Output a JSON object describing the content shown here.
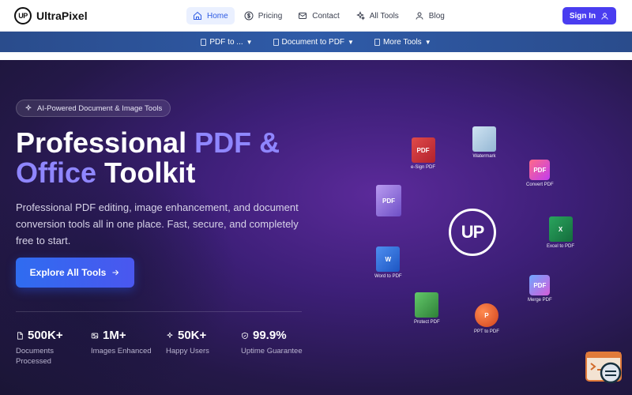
{
  "brand": {
    "logo_mark": "UP",
    "name": "UltraPixel"
  },
  "nav": {
    "items": [
      {
        "label": "Home",
        "icon": "home-icon",
        "active": true
      },
      {
        "label": "Pricing",
        "icon": "dollar-icon",
        "active": false
      },
      {
        "label": "Contact",
        "icon": "mail-icon",
        "active": false
      },
      {
        "label": "All Tools",
        "icon": "sparkles-icon",
        "active": false
      },
      {
        "label": "Blog",
        "icon": "user-icon",
        "active": false
      }
    ],
    "signin_label": "Sign In"
  },
  "subnav": {
    "items": [
      {
        "label": "PDF to ..."
      },
      {
        "label": "Document to PDF"
      },
      {
        "label": "More Tools"
      }
    ]
  },
  "hero": {
    "badge": "AI-Powered Document & Image Tools",
    "title_part1": "Professional ",
    "title_highlight1": "PDF &",
    "title_highlight2": "Office",
    "title_part2": " Toolkit",
    "description": "Professional PDF editing, image enhancement, and document conversion tools all in one place. Fast, secure, and completely free to start.",
    "cta_label": "Explore All Tools",
    "center_logo": "UP"
  },
  "stats": [
    {
      "value": "500K+",
      "label": "Documents Processed",
      "icon": "file-icon"
    },
    {
      "value": "1M+",
      "label": "Images Enhanced",
      "icon": "image-icon"
    },
    {
      "value": "50K+",
      "label": "Happy Users",
      "icon": "sparkles-icon"
    },
    {
      "value": "99.9%",
      "label": "Uptime Guarantee",
      "icon": "shield-icon"
    }
  ],
  "tools": [
    {
      "label": "e-Sign PDF",
      "icon_text": "PDF"
    },
    {
      "label": "Watermark",
      "icon_text": ""
    },
    {
      "label": "Convert PDF",
      "icon_text": "PDF"
    },
    {
      "label": "Excel to PDF",
      "icon_text": "X"
    },
    {
      "label": "Merge PDF",
      "icon_text": "PDF"
    },
    {
      "label": "PPT to PDF",
      "icon_text": "P"
    },
    {
      "label": "Protect PDF",
      "icon_text": ""
    },
    {
      "label": "Word to PDF",
      "icon_text": "W"
    },
    {
      "label": "",
      "icon_text": "PDF"
    }
  ],
  "colors": {
    "accent": "#4a3df0",
    "highlight": "#8f86ff",
    "subnav": "#2f5ba8",
    "hero_bg": "#3d1f78"
  }
}
